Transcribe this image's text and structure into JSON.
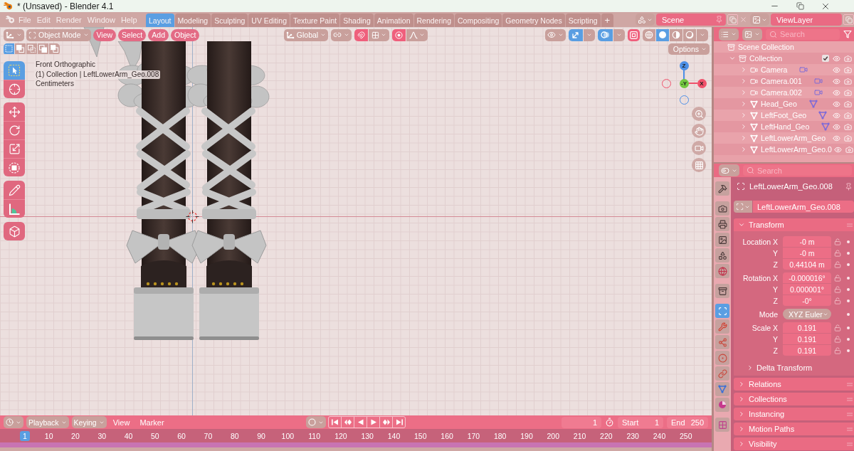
{
  "window": {
    "title": "* (Unsaved) - Blender 4.1"
  },
  "menu": [
    "File",
    "Edit",
    "Render",
    "Window",
    "Help"
  ],
  "workspaces": [
    {
      "label": "Layout",
      "selected": true
    },
    {
      "label": "Modeling",
      "selected": false
    },
    {
      "label": "Sculpting",
      "selected": false
    },
    {
      "label": "UV Editing",
      "selected": false
    },
    {
      "label": "Texture Paint",
      "selected": false
    },
    {
      "label": "Shading",
      "selected": false
    },
    {
      "label": "Animation",
      "selected": false
    },
    {
      "label": "Rendering",
      "selected": false
    },
    {
      "label": "Compositing",
      "selected": false
    },
    {
      "label": "Geometry Nodes",
      "selected": false
    },
    {
      "label": "Scripting",
      "selected": false
    }
  ],
  "add_workspace": "+",
  "scene": {
    "name": "Scene"
  },
  "view_layer": {
    "name": "ViewLayer"
  },
  "viewport": {
    "mode": "Object Mode",
    "menus": [
      "View",
      "Select",
      "Add",
      "Object"
    ],
    "orientation": "Global",
    "gizmos": {
      "on": true
    },
    "overlays": {
      "on": true
    },
    "shading": [
      {
        "kind": "wireframe",
        "selected": false
      },
      {
        "kind": "solid",
        "selected": true
      },
      {
        "kind": "material",
        "selected": false
      },
      {
        "kind": "rendered",
        "selected": false
      }
    ],
    "selection_modes": [
      {
        "selected": true
      },
      {
        "selected": false
      },
      {
        "selected": false
      },
      {
        "selected": false
      },
      {
        "selected": false
      }
    ],
    "options": "Options",
    "info": [
      "Front Orthographic",
      "(1) Collection | LeftLowerArm_Geo.008",
      "Centimeters"
    ],
    "tool_groups": [
      {
        "tools": [
          {
            "kind": "select_box",
            "selected": true
          },
          {
            "kind": "cursor",
            "selected": false
          }
        ]
      },
      {
        "tools": [
          {
            "kind": "move",
            "selected": false
          },
          {
            "kind": "rotate",
            "selected": false
          },
          {
            "kind": "scale",
            "selected": false
          },
          {
            "kind": "transform",
            "selected": false
          }
        ]
      },
      {
        "tools": [
          {
            "kind": "annotate",
            "selected": false
          },
          {
            "kind": "measure",
            "selected": false
          }
        ]
      },
      {
        "tools": [
          {
            "kind": "add_cube",
            "selected": false
          }
        ]
      }
    ],
    "gizmo_axes": [
      {
        "label": "Z",
        "color": "#4d8fe6"
      },
      {
        "label": "-Y",
        "color": "#72c73f"
      },
      {
        "label": "X",
        "color": "#f0506a"
      }
    ]
  },
  "outliner": {
    "search": {
      "placeholder": "Search"
    },
    "tree": [
      {
        "name": "Scene Collection",
        "kind": "scene_collection",
        "children": [
          {
            "name": "Collection",
            "kind": "collection",
            "expanded": true,
            "checked": true,
            "children": [
              {
                "name": "Camera",
                "kind": "camera",
                "data": {
                  "kind": "camera"
                },
                "expanded": false
              },
              {
                "name": "Camera.001",
                "kind": "camera",
                "data": {
                  "kind": "camera"
                },
                "expanded": false
              },
              {
                "name": "Camera.002",
                "kind": "camera",
                "data": {
                  "kind": "camera"
                },
                "expanded": false
              },
              {
                "name": "Head_Geo",
                "kind": "mesh",
                "data": {
                  "kind": "mesh"
                },
                "expanded": false
              },
              {
                "name": "LeftFoot_Geo",
                "kind": "mesh",
                "data": {
                  "kind": "mesh"
                },
                "expanded": false
              },
              {
                "name": "LeftHand_Geo",
                "kind": "mesh",
                "data": {
                  "kind": "mesh"
                },
                "expanded": false
              },
              {
                "name": "LeftLowerArm_Geo",
                "kind": "mesh",
                "expanded": false
              },
              {
                "name": "LeftLowerArm_Geo.0",
                "kind": "mesh",
                "expanded": false
              }
            ]
          }
        ]
      }
    ]
  },
  "properties": {
    "search": {
      "placeholder": "Search"
    },
    "tab_groups": [
      {
        "tabs": [
          {
            "kind": "tool",
            "selected": false
          }
        ]
      },
      {
        "tabs": [
          {
            "kind": "render",
            "selected": false
          },
          {
            "kind": "output",
            "selected": false
          },
          {
            "kind": "view_layer",
            "selected": false
          },
          {
            "kind": "scene",
            "selected": false
          },
          {
            "kind": "world",
            "selected": false
          }
        ]
      },
      {
        "tabs": [
          {
            "kind": "collection",
            "selected": false
          }
        ]
      },
      {
        "tabs": [
          {
            "kind": "object",
            "selected": true
          },
          {
            "kind": "modifiers",
            "selected": false
          },
          {
            "kind": "particles",
            "selected": false
          },
          {
            "kind": "physics",
            "selected": false
          },
          {
            "kind": "constraints",
            "selected": false
          },
          {
            "kind": "data",
            "selected": false
          },
          {
            "kind": "material",
            "selected": false
          }
        ]
      },
      {
        "tabs": [
          {
            "kind": "texture",
            "selected": false
          }
        ]
      }
    ],
    "object_name": "LeftLowerArm_Geo.008",
    "data_name": "LeftLowerArm_Geo.008",
    "panels": [
      {
        "title": "Transform",
        "expanded": true,
        "groups": [
          {
            "kind": "vector",
            "fields": [
              {
                "label": "Location X",
                "value": "-0 m"
              },
              {
                "label": "Y",
                "value": "-0 m"
              },
              {
                "label": "Z",
                "value": "0.44104 m"
              }
            ]
          },
          {
            "kind": "vector",
            "fields": [
              {
                "label": "Rotation X",
                "value": "-0.000016°"
              },
              {
                "label": "Y",
                "value": "0.000001°"
              },
              {
                "label": "Z",
                "value": "-0°"
              }
            ]
          },
          {
            "kind": "dropdown",
            "fields": [
              {
                "label": "Mode",
                "value": "XYZ Euler"
              }
            ]
          },
          {
            "kind": "vector",
            "fields": [
              {
                "label": "Scale X",
                "value": "0.191"
              },
              {
                "label": "Y",
                "value": "0.191"
              },
              {
                "label": "Z",
                "value": "0.191"
              }
            ]
          }
        ],
        "subpanels": [
          {
            "title": "Delta Transform",
            "expanded": false
          }
        ]
      },
      {
        "title": "Relations",
        "expanded": false
      },
      {
        "title": "Collections",
        "expanded": false
      },
      {
        "title": "Instancing",
        "expanded": false
      },
      {
        "title": "Motion Paths",
        "expanded": false
      },
      {
        "title": "Visibility",
        "expanded": false
      }
    ]
  },
  "timeline": {
    "dropdowns": [
      "Playback",
      "Keying"
    ],
    "menus": [
      "View",
      "Marker"
    ],
    "current_frame": "1",
    "start": {
      "label": "Start",
      "value": "1"
    },
    "end": {
      "label": "End",
      "value": "250"
    },
    "frames": [
      {
        "label": "1",
        "selected": true
      },
      {
        "label": "10",
        "selected": false
      },
      {
        "label": "20",
        "selected": false
      },
      {
        "label": "30",
        "selected": false
      },
      {
        "label": "40",
        "selected": false
      },
      {
        "label": "50",
        "selected": false
      },
      {
        "label": "60",
        "selected": false
      },
      {
        "label": "70",
        "selected": false
      },
      {
        "label": "80",
        "selected": false
      },
      {
        "label": "90",
        "selected": false
      },
      {
        "label": "100",
        "selected": false
      },
      {
        "label": "110",
        "selected": false
      },
      {
        "label": "120",
        "selected": false
      },
      {
        "label": "130",
        "selected": false
      },
      {
        "label": "140",
        "selected": false
      },
      {
        "label": "150",
        "selected": false
      },
      {
        "label": "160",
        "selected": false
      },
      {
        "label": "170",
        "selected": false
      },
      {
        "label": "180",
        "selected": false
      },
      {
        "label": "190",
        "selected": false
      },
      {
        "label": "200",
        "selected": false
      },
      {
        "label": "210",
        "selected": false
      },
      {
        "label": "220",
        "selected": false
      },
      {
        "label": "230",
        "selected": false
      },
      {
        "label": "240",
        "selected": false
      },
      {
        "label": "250",
        "selected": false
      }
    ]
  }
}
